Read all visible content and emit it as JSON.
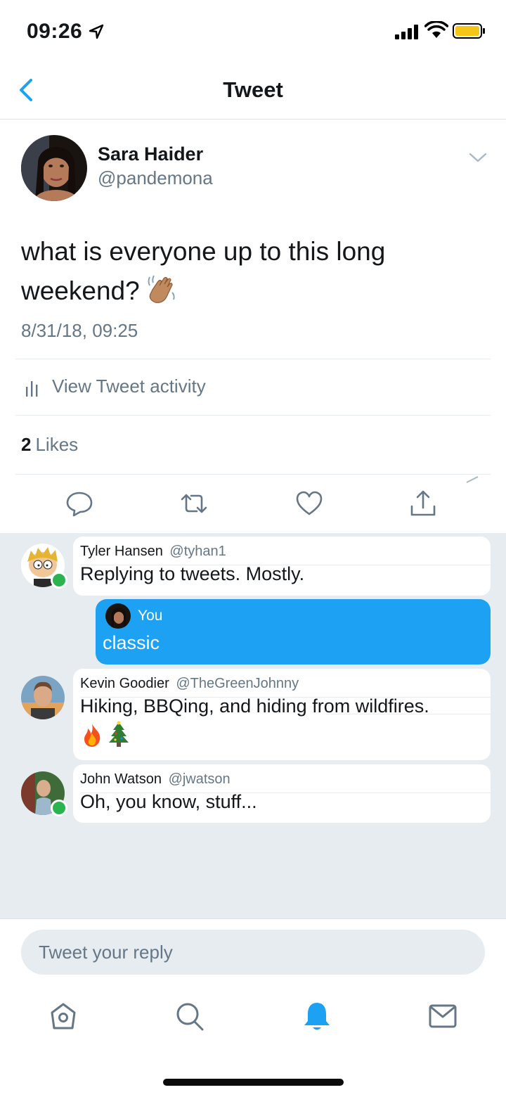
{
  "status_bar": {
    "time": "09:26"
  },
  "nav": {
    "title": "Tweet"
  },
  "tweet": {
    "author_name": "Sara Haider",
    "author_handle": "@pandemona",
    "text": "what is everyone up to this long weekend?",
    "emoji": "waving-hand",
    "timestamp": "8/31/18, 09:25",
    "activity_label": "View Tweet activity",
    "likes_count": "2",
    "likes_label": "Likes"
  },
  "replies": [
    {
      "name": "Tyler Hansen",
      "handle": "@tyhan1",
      "text": "Replying to tweets. Mostly.",
      "online": true
    },
    {
      "name": "Kevin Goodier",
      "handle": "@TheGreenJohnny",
      "text": "Hiking, BBQing, and hiding from wildfires.",
      "emojis": [
        "fire",
        "christmas-tree"
      ],
      "online": false
    },
    {
      "name": "John Watson",
      "handle": "@jwatson",
      "text": "Oh, you know, stuff...",
      "online": true
    }
  ],
  "own_reply": {
    "label": "You",
    "text": "classic"
  },
  "composer": {
    "placeholder": "Tweet your reply"
  },
  "colors": {
    "accent": "#1da1f2",
    "secondary_text": "#657786",
    "reply_bg": "#e6ecf0",
    "online": "#2ab34f"
  },
  "tabs": [
    "home-icon",
    "search-icon",
    "notifications-icon",
    "messages-icon"
  ],
  "active_tab": "notifications-icon"
}
